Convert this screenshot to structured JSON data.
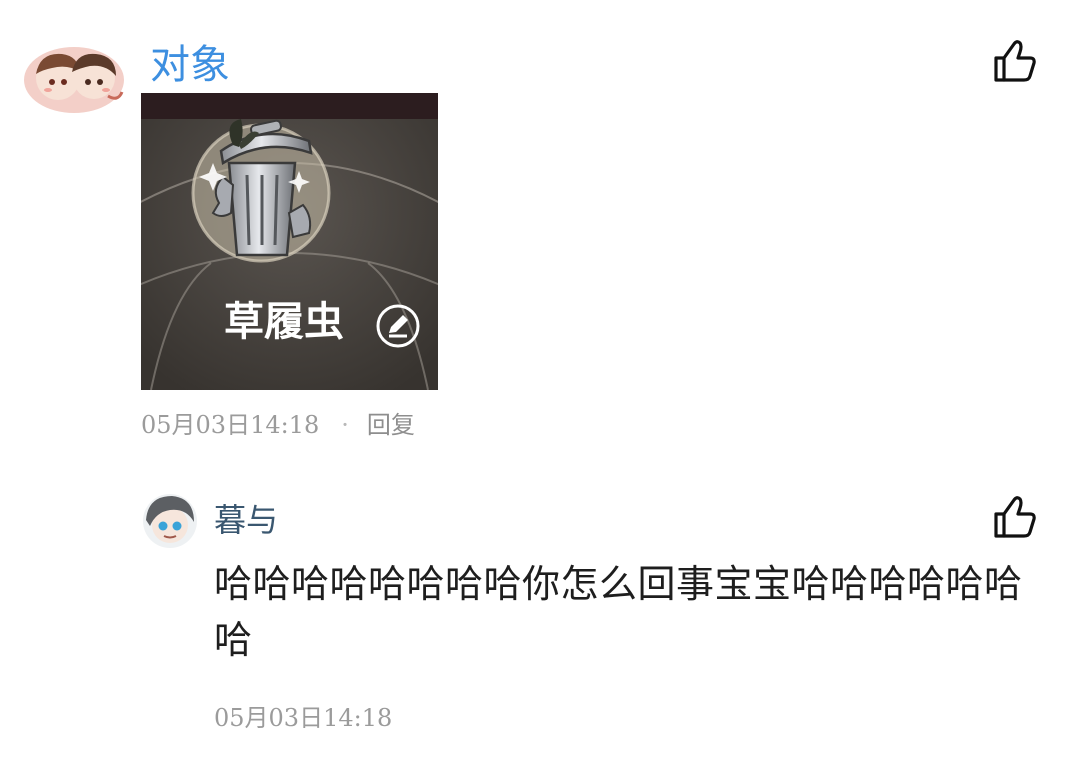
{
  "comment": {
    "username": "对象",
    "avatar_icon": "couple-avatar-icon",
    "image_caption": "草履虫",
    "image_icon": "trash-can-icon",
    "edit_icon": "pencil-icon",
    "date": "05月03日14:18",
    "separator": "·",
    "reply_label": "回复",
    "like_icon": "thumbs-up-icon"
  },
  "reply": {
    "username": "暮与",
    "avatar_icon": "user-avatar-icon",
    "text": "哈哈哈哈哈哈哈哈你怎么回事宝宝哈哈哈哈哈哈哈",
    "date": "05月03日14:18",
    "like_icon": "thumbs-up-icon"
  },
  "colors": {
    "username_primary": "#3d8fe0",
    "username_reply": "#3a5770",
    "meta_text": "#9b9b9b",
    "body_text": "#1e1e1e"
  }
}
